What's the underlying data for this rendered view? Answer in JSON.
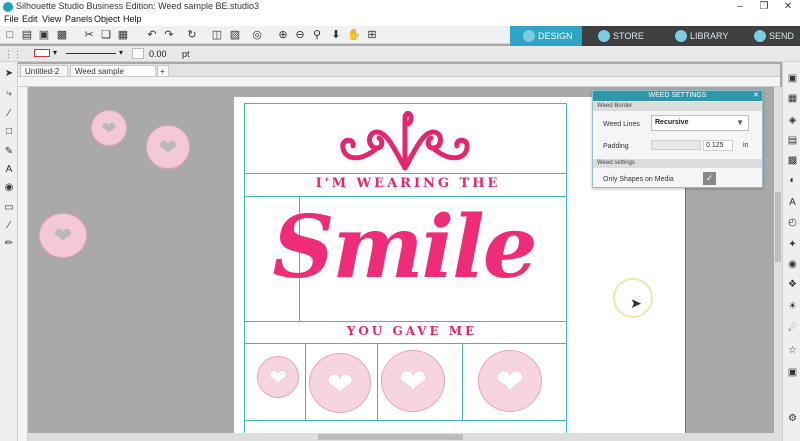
{
  "window": {
    "title": "Silhouette Studio Business Edition: Weed sample BE.studio3"
  },
  "menu": [
    "File",
    "Edit",
    "View",
    "Panels",
    "Object",
    "Help"
  ],
  "navtabs": [
    {
      "label": "DESIGN",
      "active": true
    },
    {
      "label": "STORE",
      "active": false
    },
    {
      "label": "LIBRARY",
      "active": false
    },
    {
      "label": "SEND",
      "active": false
    }
  ],
  "propbar": {
    "line_width": "0.00",
    "unit": "pt"
  },
  "doctabs": [
    "Untitled-2",
    "Weed sample BE.stu..."
  ],
  "design": {
    "line1": "I'M WEARING THE",
    "smile": "Smile",
    "line2": "YOU GAVE ME"
  },
  "weed_panel": {
    "title": "WEED SETTINGS",
    "section_border": "Weed Border",
    "weed_lines_label": "Weed Lines",
    "weed_lines_value": "Recursive",
    "padding_label": "Padding",
    "padding_value": "0.125",
    "padding_unit": "in",
    "section_settings": "Weed settings",
    "only_shapes_label": "Only Shapes on Media",
    "only_shapes_checked": true
  },
  "icons": {
    "heart": "heart-icon",
    "cursor": "cursor-pointer-icon"
  },
  "colors": {
    "accent": "#2fa4c7",
    "design_pink": "#ee2c78",
    "weed_line": "#3fb8c4",
    "cut_border": "#e5337a"
  }
}
